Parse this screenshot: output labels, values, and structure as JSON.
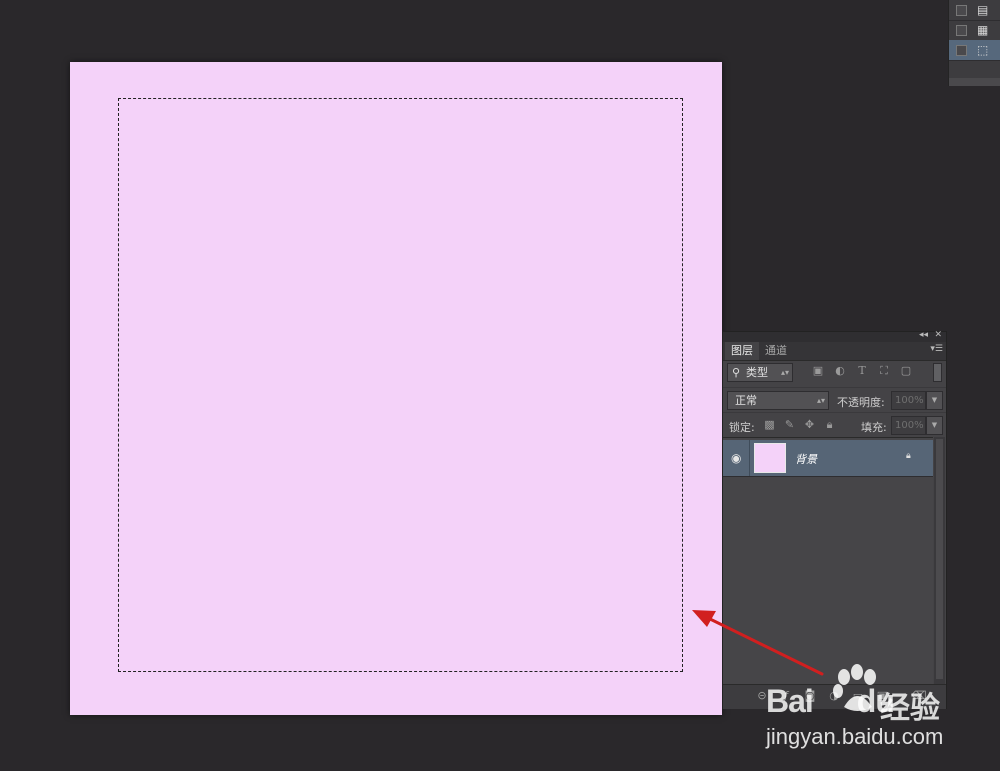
{
  "canvas": {
    "fill_color": "#f4d2f9",
    "selection": "dashed-marquee"
  },
  "mini_panel": {
    "items": [
      {
        "icon": "document-icon",
        "active": false
      },
      {
        "icon": "list-icon",
        "active": false
      },
      {
        "icon": "selection-icon",
        "active": true
      }
    ]
  },
  "layers_panel": {
    "tabs": [
      {
        "label": "图层",
        "active": true
      },
      {
        "label": "通道",
        "active": false
      }
    ],
    "filter": {
      "kind_label": "类型",
      "icons": [
        "image-filter-icon",
        "adjustment-filter-icon",
        "type-filter-icon",
        "shape-filter-icon",
        "smart-object-filter-icon"
      ]
    },
    "blend_mode": "正常",
    "opacity_label": "不透明度:",
    "opacity_value": "100%",
    "lock_label": "锁定:",
    "lock_icons": [
      "lock-transparent-icon",
      "lock-paint-icon",
      "lock-position-icon",
      "lock-all-icon"
    ],
    "fill_label": "填充:",
    "fill_value": "100%",
    "layers": [
      {
        "name": "背景",
        "visible": true,
        "locked": true,
        "thumb_color": "#f4d2f9"
      }
    ],
    "footer_icons": [
      "link-icon",
      "fx-icon",
      "mask-icon",
      "adjustment-icon",
      "group-icon",
      "new-layer-icon",
      "trash-icon"
    ]
  },
  "annotation": {
    "arrow_color": "#d11f1f"
  },
  "watermark": {
    "logo_text": "Bai",
    "logo_text_2": "du",
    "chinese_text": "经验",
    "url": "jingyan.baidu.com"
  }
}
